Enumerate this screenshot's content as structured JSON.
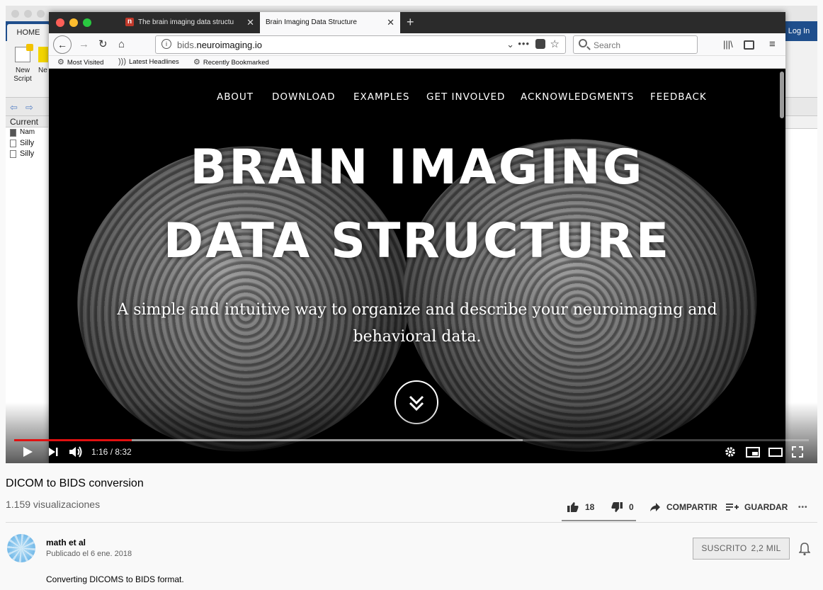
{
  "background_app": {
    "home_tab": "HOME",
    "login": "Log In",
    "new_script": "New\nScript",
    "new2": "Ne",
    "current_folder": "Current",
    "files_header": "Nam",
    "files": [
      "Silly",
      "Silly"
    ]
  },
  "browser": {
    "tabs": [
      {
        "title": "The brain imaging data structu",
        "favicon": "n"
      },
      {
        "title": "Brain Imaging Data Structure"
      }
    ],
    "url_prefix": "bids.",
    "url_domain": "neuroimaging.io",
    "search_placeholder": "Search",
    "bookmarks": [
      "Most Visited",
      "Latest Headlines",
      "Recently Bookmarked"
    ]
  },
  "website": {
    "menu": [
      "ABOUT",
      "DOWNLOAD",
      "EXAMPLES",
      "GET INVOLVED",
      "ACKNOWLEDGMENTS",
      "FEEDBACK"
    ],
    "title_line1": "BRAIN IMAGING",
    "title_line2": "DATA STRUCTURE",
    "subtitle_line1": "A simple and intuitive way to organize and describe your neuroimaging and",
    "subtitle_line2": "behavioral data."
  },
  "player": {
    "time": "1:16 / 8:32",
    "played_fraction": 0.148,
    "buffered_fraction": 0.64
  },
  "video": {
    "title": "DICOM to BIDS conversion",
    "views": "1.159 visualizaciones",
    "likes": "18",
    "dislikes": "0",
    "share": "COMPARTIR",
    "save": "GUARDAR",
    "more": "•••"
  },
  "channel": {
    "name": "math et al",
    "published": "Publicado el 6 ene. 2018",
    "subscribe_label": "SUSCRITO",
    "subscribers": "2,2 MIL",
    "description": "Converting DICOMS to BIDS format."
  },
  "colors": {
    "progress_played": "#e01010",
    "firefox_chrome": "#2b2b2b"
  }
}
